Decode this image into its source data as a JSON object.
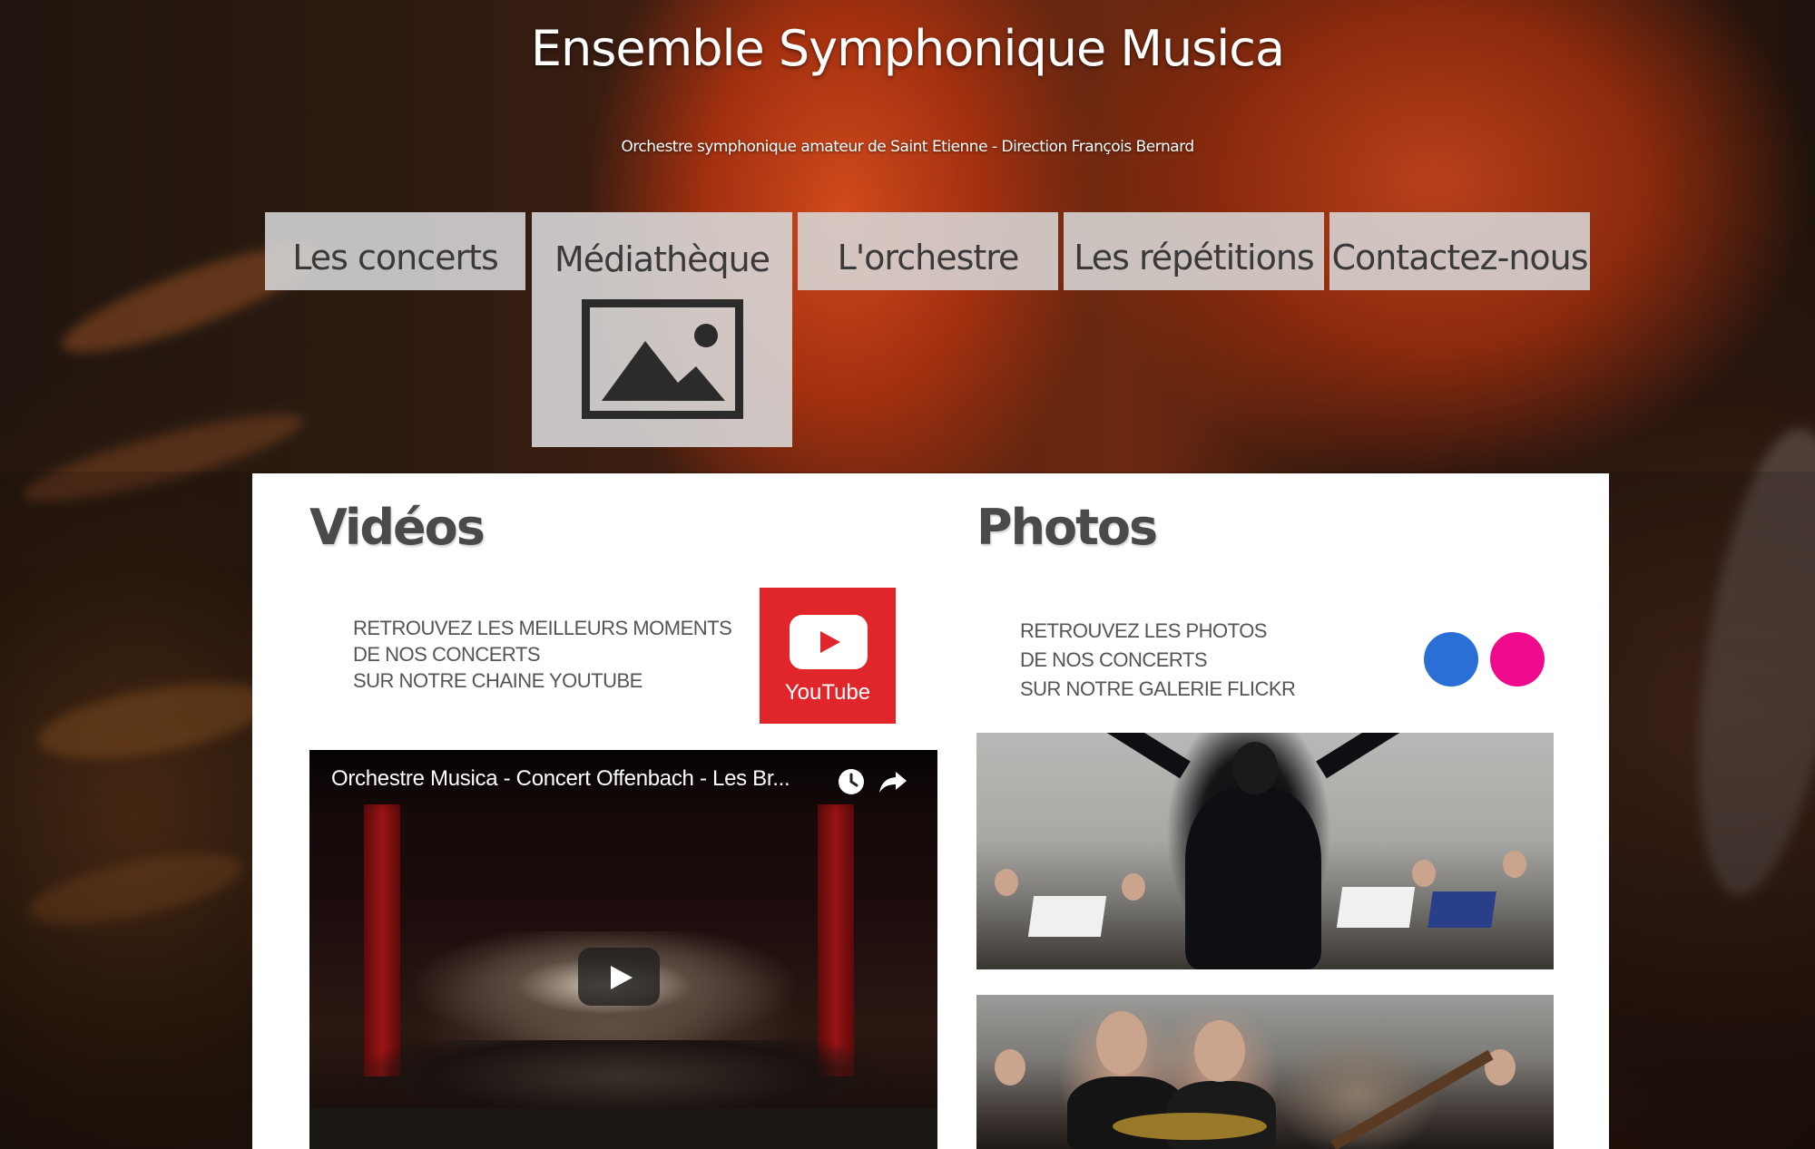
{
  "header": {
    "title": "Ensemble Symphonique Musica",
    "subtitle": "Orchestre symphonique amateur de Saint Etienne - Direction François Bernard"
  },
  "nav": {
    "items": [
      {
        "label": "Les concerts"
      },
      {
        "label": "Médiathèque",
        "active": true,
        "icon": "image-icon"
      },
      {
        "label": "L'orchestre"
      },
      {
        "label": "Les répétitions"
      },
      {
        "label": "Contactez-nous"
      }
    ]
  },
  "videos": {
    "title": "Vidéos",
    "promo": [
      "RETROUVEZ LES MEILLEURS MOMENTS",
      "DE NOS CONCERTS",
      "SUR NOTRE CHAINE YOUTUBE"
    ],
    "youtube_label": "YouTube",
    "embed": {
      "title": "Orchestre Musica - Concert Offenbach - Les Br..."
    }
  },
  "photos": {
    "title": "Photos",
    "promo": [
      "RETROUVEZ LES PHOTOS",
      "DE NOS CONCERTS",
      "SUR NOTRE GALERIE FLICKR"
    ],
    "flickr_colors": [
      "#2a6fd6",
      "#ef0a8c"
    ]
  },
  "colors": {
    "youtube_red": "#e0262b",
    "nav_bg": "#d7d7d7"
  }
}
